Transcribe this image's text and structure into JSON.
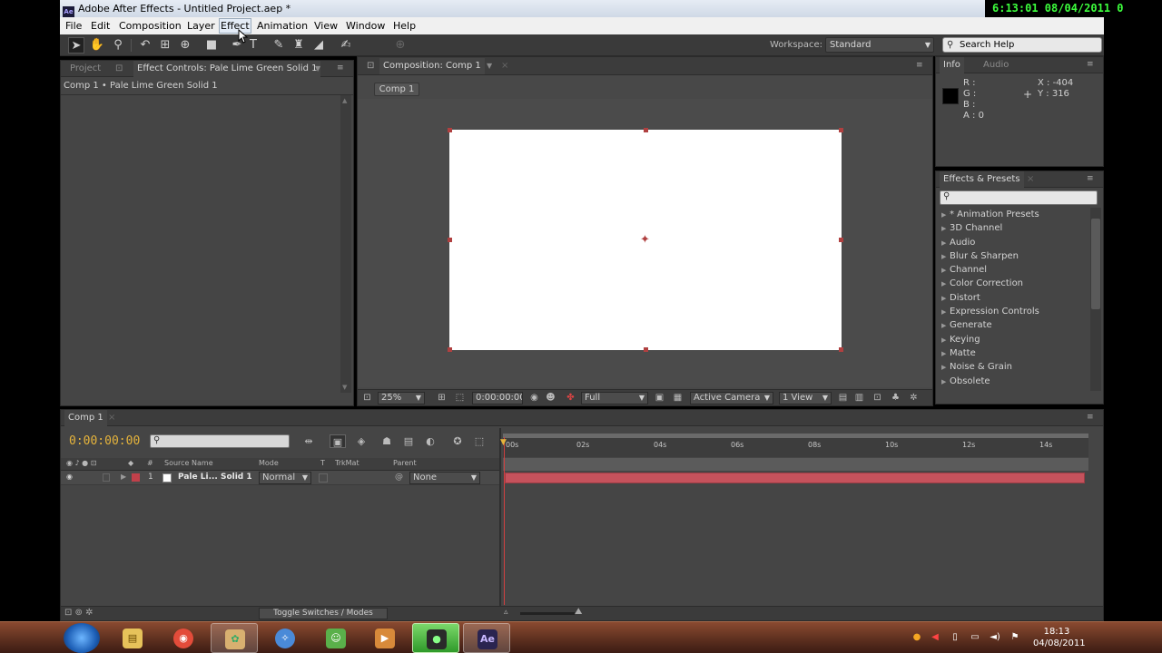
{
  "overlay_clock": "6:13:01  08/04/2011 0",
  "window": {
    "title": "Adobe After Effects - Untitled Project.aep *",
    "app_icon": "Ae"
  },
  "menubar": {
    "items": [
      "File",
      "Edit",
      "Composition",
      "Layer",
      "Effect",
      "Animation",
      "View",
      "Window",
      "Help"
    ],
    "hovered": "Effect"
  },
  "toolbar": {
    "tools": [
      "selection-tool-icon",
      "hand-tool-icon",
      "zoom-tool-icon",
      "rotation-tool-icon",
      "camera-orbit-icon",
      "pan-behind-icon",
      "rectangle-tool-icon",
      "pen-tool-icon",
      "text-tool-icon",
      "brush-tool-icon",
      "clone-stamp-icon",
      "eraser-icon",
      "puppet-pin-icon"
    ],
    "workspace_label": "Workspace:",
    "workspace_value": "Standard",
    "search_placeholder": "Search Help"
  },
  "left_panel": {
    "tabs": [
      "Project",
      "Effect Controls: Pale Lime Green Solid 1"
    ],
    "layer_path": "Comp 1 • Pale Lime Green Solid 1"
  },
  "composition_panel": {
    "tab": "Composition: Comp 1",
    "flowchart_button": "Comp 1",
    "canvas_color": "#ffffff",
    "footer": {
      "magnification": "25%",
      "timecode": "0:00:00:00",
      "resolution": "Full",
      "camera": "Active Camera",
      "views": "1 View"
    }
  },
  "info_panel": {
    "tabs": [
      "Info",
      "Audio"
    ],
    "r": "R :",
    "g": "G :",
    "b": "B :",
    "a": "A : 0",
    "x": "X : -404",
    "y": "Y : 316"
  },
  "effects_presets": {
    "title": "Effects & Presets",
    "items": [
      "* Animation Presets",
      "3D Channel",
      "Audio",
      "Blur & Sharpen",
      "Channel",
      "Color Correction",
      "Distort",
      "Expression Controls",
      "Generate",
      "Keying",
      "Matte",
      "Noise & Grain",
      "Obsolete"
    ]
  },
  "timeline": {
    "tab": "Comp 1",
    "timecode": "0:00:00:00",
    "columns": {
      "num": "#",
      "source": "Source Name",
      "mode": "Mode",
      "t": "T",
      "trkmat": "TrkMat",
      "parent": "Parent"
    },
    "layer": {
      "index": "1",
      "name": "Pale Li... Solid 1",
      "mode": "Normal",
      "parent": "None",
      "label_color": "#c0404a"
    },
    "ruler_ticks": [
      "00s",
      "02s",
      "04s",
      "06s",
      "08s",
      "10s",
      "12s",
      "14s"
    ],
    "toggle_label": "Toggle Switches / Modes"
  },
  "taskbar": {
    "apps": [
      "explorer-icon",
      "chrome-icon",
      "paint-icon",
      "safari-icon",
      "messenger-icon",
      "media-icon",
      "camtasia-icon",
      "after-effects-icon"
    ],
    "ae_label": "Ae",
    "time": "18:13",
    "date": "04/08/2011"
  }
}
